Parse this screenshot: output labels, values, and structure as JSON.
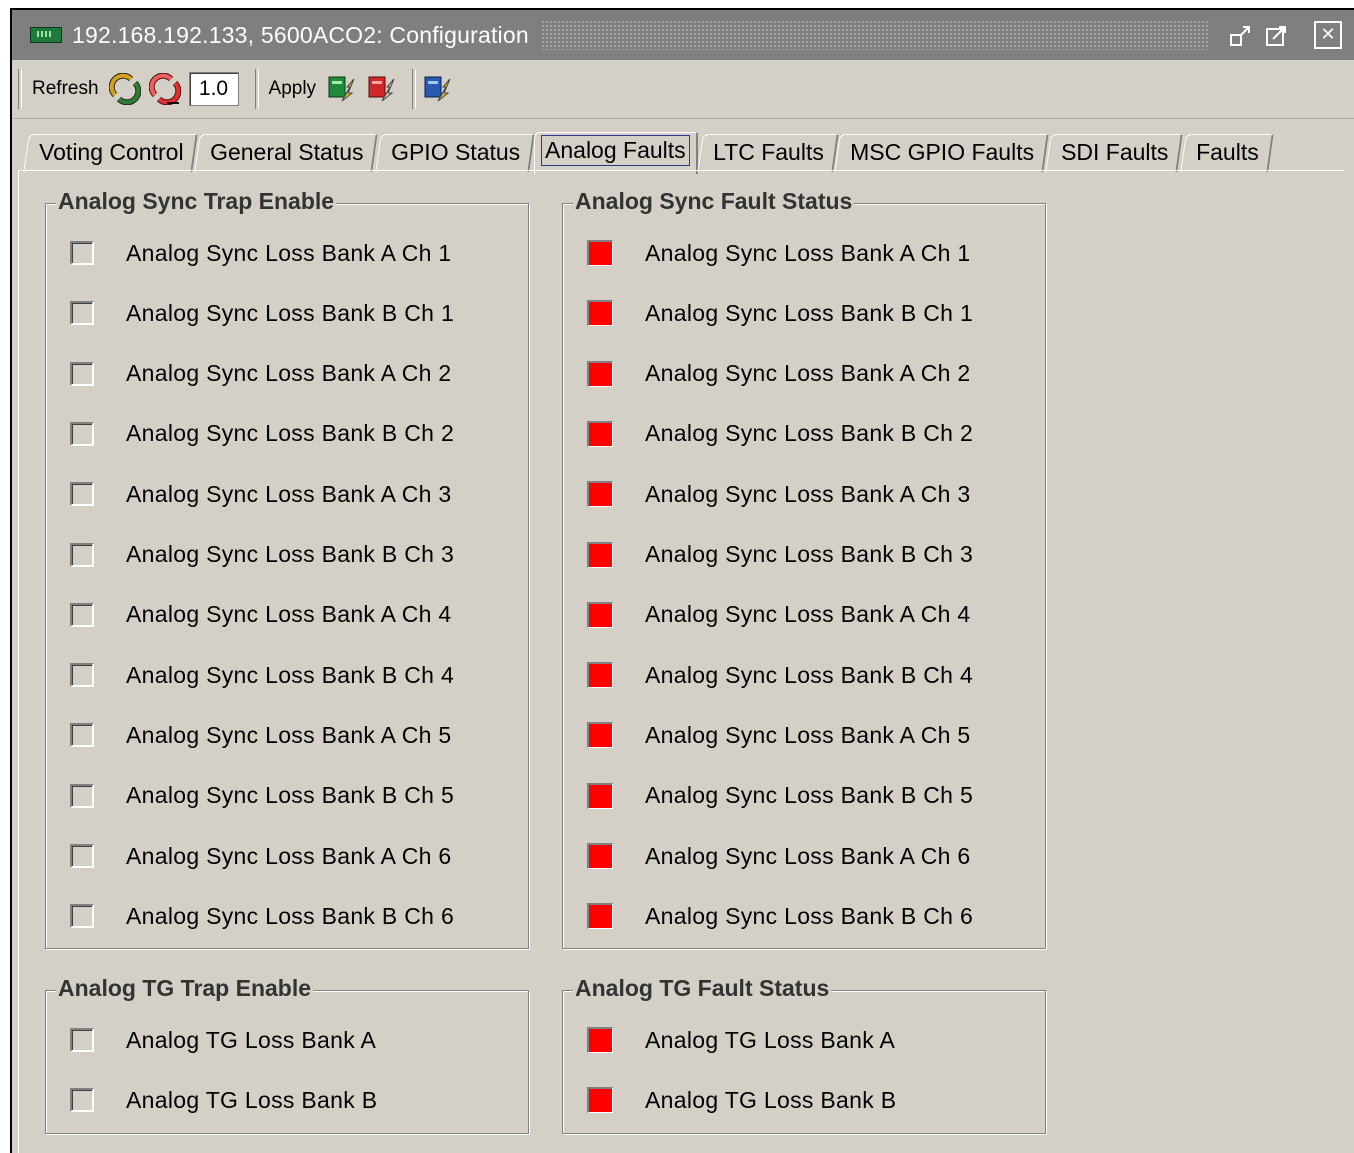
{
  "window": {
    "title": "192.168.192.133, 5600ACO2: Configuration",
    "icons": [
      "card-icon",
      "restore-icon",
      "maximize-icon",
      "close-icon"
    ]
  },
  "toolbar": {
    "refresh_label": "Refresh",
    "version_value": "1.0",
    "apply_label": "Apply"
  },
  "tabs": [
    {
      "label": "Voting Control"
    },
    {
      "label": "General Status"
    },
    {
      "label": "GPIO Status"
    },
    {
      "label": "Analog Faults",
      "active": true
    },
    {
      "label": "LTC Faults"
    },
    {
      "label": "MSC GPIO Faults"
    },
    {
      "label": "SDI Faults"
    },
    {
      "label": "Faults"
    }
  ],
  "sync_trap": {
    "title": "Analog Sync Trap Enable",
    "items": [
      {
        "label": "Analog Sync Loss Bank A Ch 1",
        "checked": false
      },
      {
        "label": "Analog Sync Loss Bank B Ch 1",
        "checked": false
      },
      {
        "label": "Analog Sync Loss Bank A Ch 2",
        "checked": false
      },
      {
        "label": "Analog Sync Loss Bank B Ch 2",
        "checked": false
      },
      {
        "label": "Analog Sync Loss Bank A Ch 3",
        "checked": false
      },
      {
        "label": "Analog Sync Loss Bank B Ch 3",
        "checked": false
      },
      {
        "label": "Analog Sync Loss Bank A Ch 4",
        "checked": false
      },
      {
        "label": "Analog Sync Loss Bank B Ch 4",
        "checked": false
      },
      {
        "label": "Analog Sync Loss Bank A Ch 5",
        "checked": false
      },
      {
        "label": "Analog Sync Loss Bank B Ch 5",
        "checked": false
      },
      {
        "label": "Analog Sync Loss Bank A Ch 6",
        "checked": false
      },
      {
        "label": "Analog Sync Loss Bank B Ch 6",
        "checked": false
      }
    ]
  },
  "sync_status": {
    "title": "Analog Sync Fault Status",
    "status_color": "#ff0000",
    "items": [
      {
        "label": "Analog Sync Loss Bank A Ch 1"
      },
      {
        "label": "Analog Sync Loss Bank B Ch 1"
      },
      {
        "label": "Analog Sync Loss Bank A Ch 2"
      },
      {
        "label": "Analog Sync Loss Bank B Ch 2"
      },
      {
        "label": "Analog Sync Loss Bank A Ch 3"
      },
      {
        "label": "Analog Sync Loss Bank B Ch 3"
      },
      {
        "label": "Analog Sync Loss Bank A Ch 4"
      },
      {
        "label": "Analog Sync Loss Bank B Ch 4"
      },
      {
        "label": "Analog Sync Loss Bank A Ch 5"
      },
      {
        "label": "Analog Sync Loss Bank B Ch 5"
      },
      {
        "label": "Analog Sync Loss Bank A Ch 6"
      },
      {
        "label": "Analog Sync Loss Bank B Ch 6"
      }
    ]
  },
  "tg_trap": {
    "title": "Analog TG Trap Enable",
    "items": [
      {
        "label": "Analog TG Loss Bank A",
        "checked": false
      },
      {
        "label": "Analog TG Loss Bank B",
        "checked": false
      }
    ]
  },
  "tg_status": {
    "title": "Analog TG Fault Status",
    "status_color": "#ff0000",
    "items": [
      {
        "label": "Analog TG Loss Bank A"
      },
      {
        "label": "Analog TG Loss Bank B"
      }
    ]
  }
}
